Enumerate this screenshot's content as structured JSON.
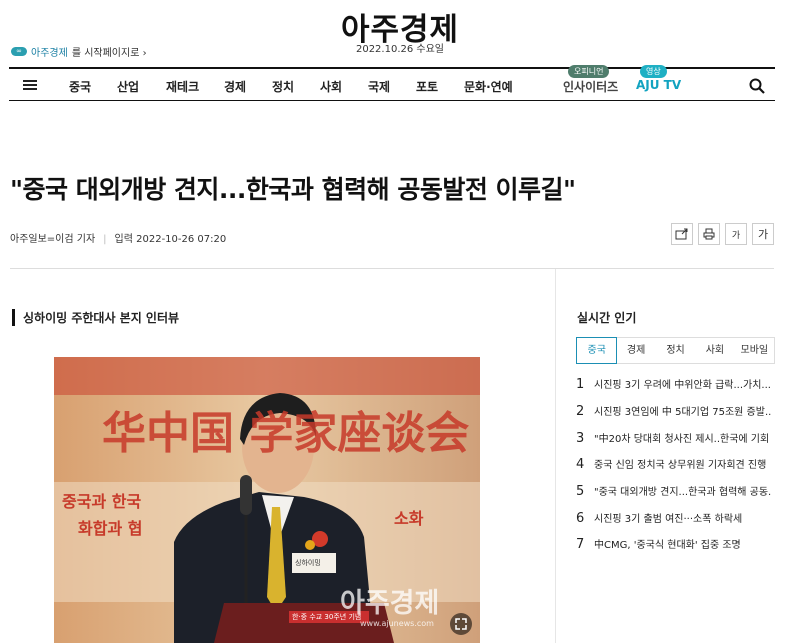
{
  "header": {
    "logo": "아주경제",
    "date": "2022.10.26  수요일",
    "home_set": {
      "brand": "아주경제",
      "text": "를 시작페이지로 ›"
    }
  },
  "nav": {
    "items": [
      "중국",
      "산업",
      "재테크",
      "경제",
      "정치",
      "사회",
      "국제",
      "포토",
      "문화·연예"
    ],
    "insighters": {
      "badge": "오피니언",
      "label": "인사이터즈"
    },
    "ajutv": {
      "badge": "영상",
      "label": "AJU TV"
    }
  },
  "article": {
    "headline": "\"중국 대외개방 견지...한국과 협력해 공동발전 이루길\"",
    "reporter": "아주일보=이검 기자",
    "published": "입력 2022-10-26 07:20",
    "tools": {
      "share": "",
      "print": "",
      "font_small": "가",
      "font_large": "가"
    },
    "subtitle": "싱하이밍 주한대사 본지 인터뷰",
    "photo": {
      "banner_chars": "华中国 学家座谈会",
      "banner_kr1": "중국과 한국",
      "banner_kr2": "화합과 협",
      "banner_kr3": "소화",
      "watermark": "아주경제",
      "watermark_url": "www.ajunews.com",
      "podium_text": "한·중 수교 30주년 기념",
      "nametag": "싱하이밍"
    }
  },
  "sidebar": {
    "title": "실시간 인기",
    "tabs": [
      "중국",
      "경제",
      "정치",
      "사회",
      "모바일"
    ],
    "active_tab": 0,
    "ranks": [
      {
        "n": "1",
        "text": "시진핑 3기 우려에 中위안화 급락...가치..."
      },
      {
        "n": "2",
        "text": "시진핑 3연임에 中 5대기업 75조원 증발..."
      },
      {
        "n": "3",
        "text": "\"中20차 당대회 청사진 제시..한국에 기회 ..."
      },
      {
        "n": "4",
        "text": "중국 신임 정치국 상무위원 기자회견 진행"
      },
      {
        "n": "5",
        "text": "\"중국 대외개방 견지...한국과 협력해 공동..."
      },
      {
        "n": "6",
        "text": "시진핑 3기 출범 여진···소폭 하락세"
      },
      {
        "n": "7",
        "text": "中CMG, '중국식 현대화' 집중 조명"
      }
    ]
  },
  "colors": {
    "accent": "#1b8fb4",
    "insighters_badge": "#4f7d6c",
    "tv_badge": "#1fb0c4",
    "tv_label": "#12a3c0"
  }
}
